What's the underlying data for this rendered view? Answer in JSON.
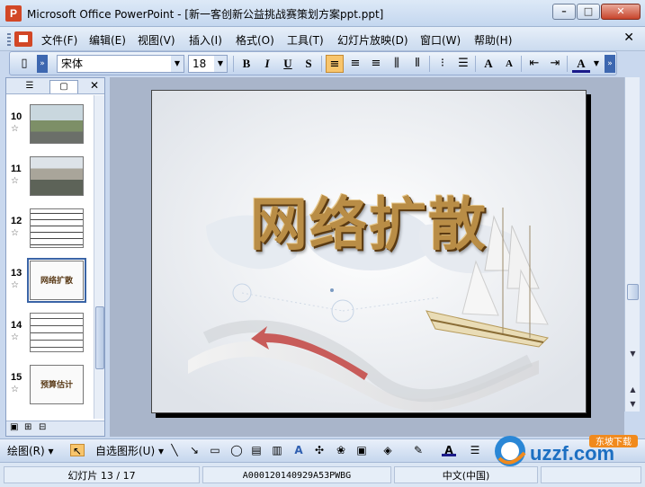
{
  "window": {
    "app_icon_letter": "P",
    "title": "Microsoft Office PowerPoint - [新一客创新公益挑战赛策划方案ppt.ppt]",
    "min_label": "–",
    "max_label": "□",
    "close_label": "✕"
  },
  "menu": {
    "items": [
      "文件(F)",
      "编辑(E)",
      "视图(V)",
      "插入(I)",
      "格式(O)",
      "工具(T)",
      "幻灯片放映(D)",
      "窗口(W)",
      "帮助(H)"
    ],
    "close_label": "✕"
  },
  "format_toolbar": {
    "font_name": "宋体",
    "font_size": "18",
    "bold": "B",
    "italic": "I",
    "underline": "U",
    "shadow": "S"
  },
  "left_panel": {
    "tab_outline": "☰",
    "tab_slides": "▢",
    "close_label": "✕",
    "slides": [
      {
        "num": "10",
        "label": ""
      },
      {
        "num": "11",
        "label": ""
      },
      {
        "num": "12",
        "label": ""
      },
      {
        "num": "13",
        "label": "网络扩散"
      },
      {
        "num": "14",
        "label": ""
      },
      {
        "num": "15",
        "label": "预算估计"
      }
    ],
    "star": "☆"
  },
  "slide": {
    "title": "网络扩散"
  },
  "draw_toolbar": {
    "draw_label": "绘图(R)",
    "autoshapes_label": "自选图形(U)"
  },
  "status": {
    "slide_indicator": "幻灯片 13 / 17",
    "template": "A000120140929A53PWBG",
    "language": "中文(中国)"
  },
  "watermark": {
    "text": "uzzf.com",
    "sub": "东坡下载"
  },
  "colors": {
    "title_gold": "#b98d46",
    "ppt_orange": "#d24726",
    "selection_blue": "#3a64a6"
  }
}
